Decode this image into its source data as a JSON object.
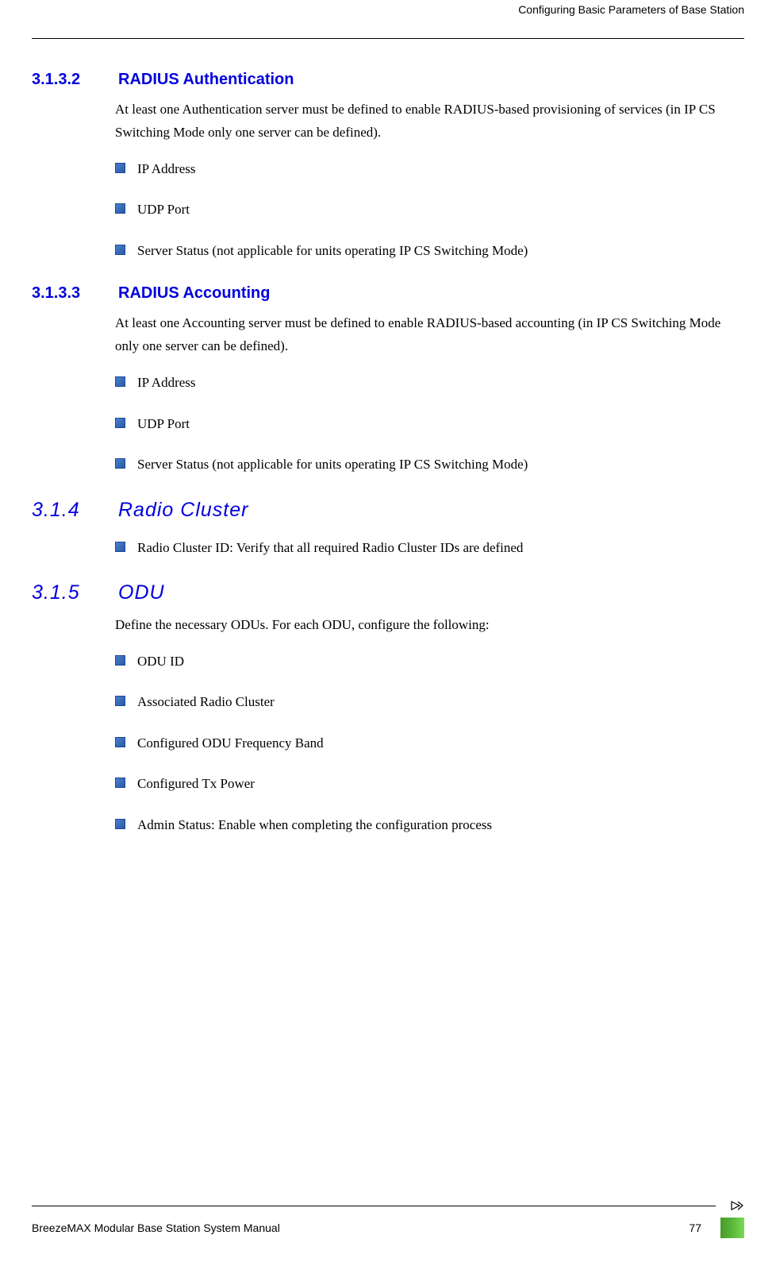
{
  "header": {
    "right": "Configuring Basic Parameters of Base Station"
  },
  "sections": {
    "s1": {
      "num": "3.1.3.2",
      "title": "RADIUS Authentication",
      "body": "At least one Authentication server must be defined to enable RADIUS-based provisioning of services (in IP CS Switching Mode only one server can be defined).",
      "items": {
        "i0": "IP Address",
        "i1": "UDP Port",
        "i2": "Server Status (not applicable for units operating IP CS Switching Mode)"
      }
    },
    "s2": {
      "num": "3.1.3.3",
      "title": "RADIUS Accounting",
      "body": "At least one Accounting server must be defined to enable RADIUS-based accounting (in IP CS Switching Mode only one server can be defined).",
      "items": {
        "i0": "IP Address",
        "i1": "UDP Port",
        "i2": "Server Status (not applicable for units operating IP CS Switching Mode)"
      }
    },
    "s3": {
      "num": "3.1.4",
      "title": "Radio Cluster",
      "items": {
        "i0": "Radio Cluster ID: Verify that all required Radio Cluster IDs are defined"
      }
    },
    "s4": {
      "num": "3.1.5",
      "title": "ODU",
      "body": "Define the necessary ODUs. For each ODU, configure the following:",
      "items": {
        "i0": "ODU ID",
        "i1": "Associated Radio Cluster",
        "i2": "Configured ODU Frequency Band",
        "i3": "Configured Tx Power",
        "i4": "Admin Status: Enable when completing the configuration process"
      }
    }
  },
  "footer": {
    "left": "BreezeMAX Modular Base Station System Manual",
    "page": "77"
  }
}
